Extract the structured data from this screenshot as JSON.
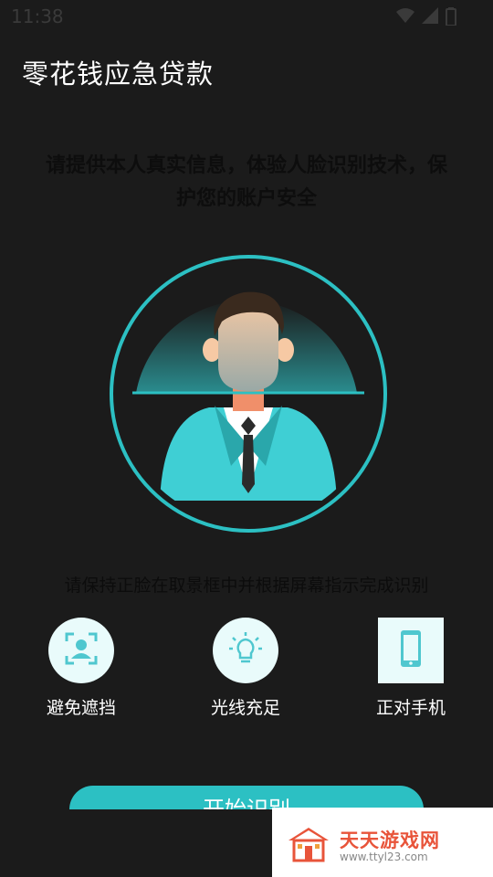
{
  "status_bar": {
    "time": "11:38",
    "icons": [
      "wifi-icon",
      "signal-icon",
      "battery-icon"
    ]
  },
  "header": {
    "title": "零花钱应急贷款"
  },
  "intro": {
    "text": "请提供本人真实信息，体验人脸识别技术，保护您的账户安全"
  },
  "instruction": {
    "text": "请保持正脸在取景框中并根据屏幕指示完成识别"
  },
  "tips": [
    {
      "label": "避免遮挡",
      "icon": "face-scan-icon"
    },
    {
      "label": "光线充足",
      "icon": "lightbulb-icon"
    },
    {
      "label": "正对手机",
      "icon": "phone-icon"
    }
  ],
  "start_button": {
    "label": "开始识别"
  },
  "watermark": {
    "name": "天天游戏网",
    "url": "www.ttyl23.com"
  },
  "colors": {
    "accent": "#2cc0c3",
    "background": "#1b1b1b",
    "tip_bg": "#e9fbfb",
    "watermark": "#e8543a"
  }
}
